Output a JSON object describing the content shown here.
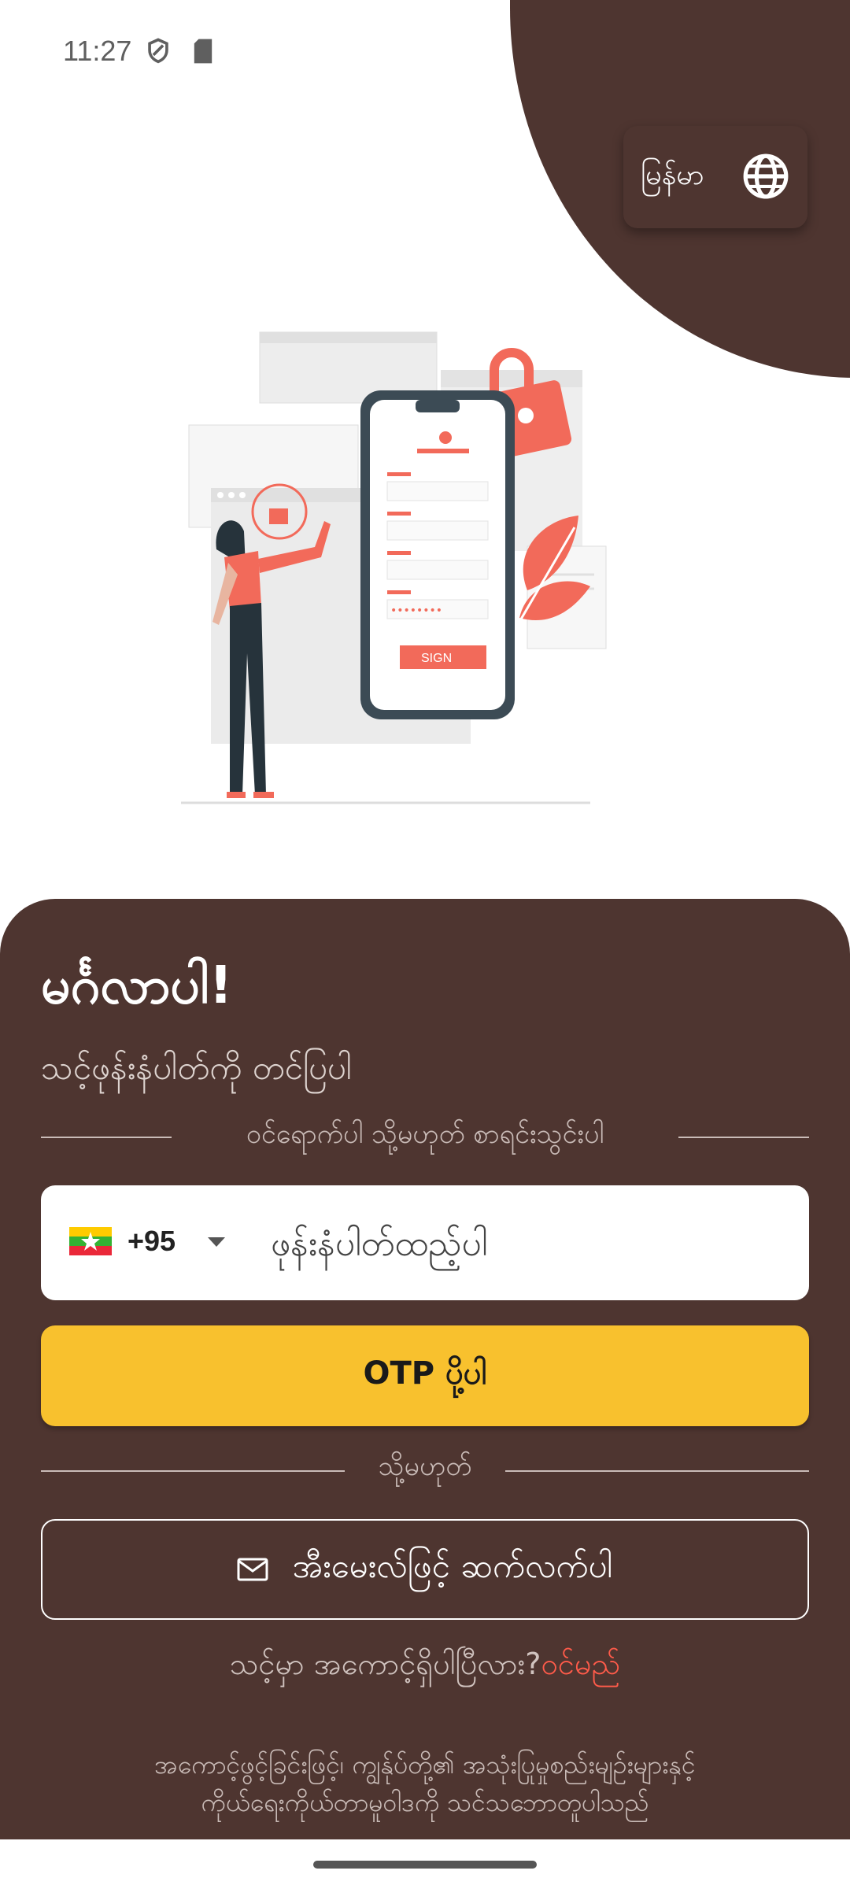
{
  "status_bar": {
    "time": "11:27"
  },
  "header": {
    "language_label": "မြန်မာ"
  },
  "illustration": {
    "sign_label": "SIGN",
    "password_mask": "••••••••"
  },
  "login": {
    "welcome": "မင်္ဂလာပါ!",
    "subtitle": "သင့်ဖုန်းနံပါတ်ကို တင်ပြပါ",
    "divider_text": "ဝင်ရောက်ပါ သို့မဟုတ် စာရင်းသွင်းပါ",
    "country_code": "+95",
    "phone_placeholder": "ဖုန်းနံပါတ်ထည့်ပါ",
    "otp_button": "OTP ပို့ပါ",
    "or_text": "သို့မဟုတ်",
    "email_button": "အီးမေးလ်ဖြင့် ဆက်လက်ပါ",
    "account_question": "သင့်မှာ အကောင့်ရှိပါပြီလား?",
    "login_link": "ဝင်မည်",
    "terms_line1": "အကောင့်ဖွင့်ခြင်းဖြင့်၊ ကျွန်ုပ်တို့၏ အသုံးပြုမှုစည်းမျဉ်းများနှင့်",
    "terms_line2": "ကိုယ်ရေးကိုယ်တာမူဝါဒကို သင်သဘောတူပါသည်"
  },
  "colors": {
    "panel": "#4e3530",
    "accent_yellow": "#f8c12e",
    "link_red": "#ff5b4a",
    "illustration_coral": "#f26a5a"
  },
  "icons": [
    "shield-icon",
    "sd-card-icon",
    "wifi-icon",
    "signal-icon",
    "battery-icon",
    "globe-icon",
    "chevron-down-icon",
    "mail-icon",
    "myanmar-flag-icon"
  ]
}
